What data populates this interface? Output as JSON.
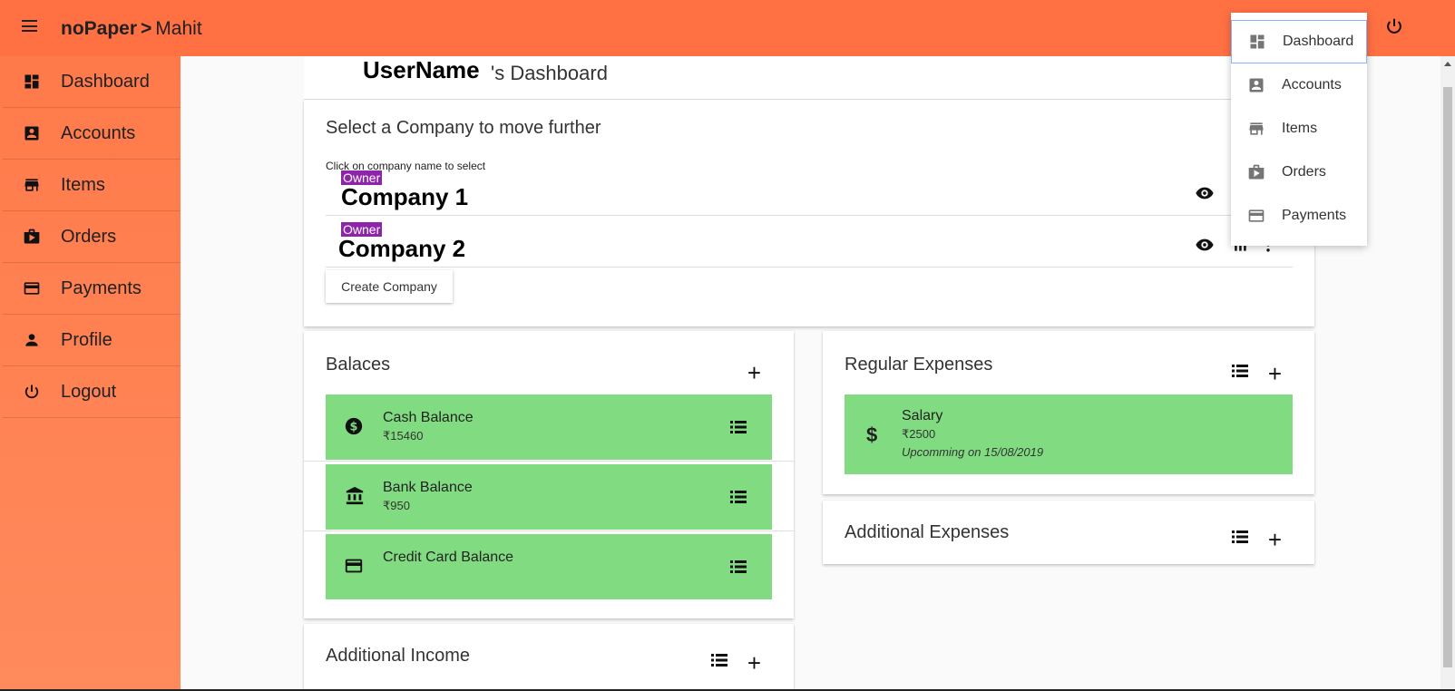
{
  "header": {
    "app_name": "noPaper",
    "separator": ">",
    "user": "Mahit"
  },
  "sidebar": {
    "items": [
      {
        "label": "Dashboard",
        "icon": "dashboard-icon"
      },
      {
        "label": "Accounts",
        "icon": "account-box-icon"
      },
      {
        "label": "Items",
        "icon": "store-icon"
      },
      {
        "label": "Orders",
        "icon": "shop-icon"
      },
      {
        "label": "Payments",
        "icon": "credit-card-icon"
      },
      {
        "label": "Profile",
        "icon": "person-icon"
      },
      {
        "label": "Logout",
        "icon": "power-icon"
      }
    ]
  },
  "dashboard": {
    "username": "UserName",
    "title_suffix": "'s Dashboard"
  },
  "companies": {
    "title": "Select a Company to move further",
    "hint": "Click on company name to select",
    "rows": [
      {
        "role": "Owner",
        "name": "Company 1"
      },
      {
        "role": "Owner",
        "name": "Company 2"
      }
    ],
    "create_label": "Create Company"
  },
  "balances": {
    "title": "Balaces",
    "items": [
      {
        "name": "Cash Balance",
        "value": "₹15460",
        "icon": "dollar-circle-icon"
      },
      {
        "name": "Bank Balance",
        "value": "₹950",
        "icon": "bank-icon"
      },
      {
        "name": "Credit Card Balance",
        "value": "",
        "icon": "credit-card-icon"
      }
    ]
  },
  "regular_expenses": {
    "title": "Regular Expenses",
    "items": [
      {
        "name": "Salary",
        "value": "₹2500",
        "note": "Upcomming on 15/08/2019"
      }
    ]
  },
  "additional_expenses": {
    "title": "Additional Expenses"
  },
  "additional_income": {
    "title": "Additional Income"
  },
  "menu": {
    "items": [
      {
        "label": "Dashboard",
        "active": true
      },
      {
        "label": "Accounts"
      },
      {
        "label": "Items"
      },
      {
        "label": "Orders"
      },
      {
        "label": "Payments"
      }
    ]
  },
  "colors": {
    "topbar": "#ff7043",
    "sidebar": "#ff8a5c",
    "balance_green": "#81dc81",
    "owner_tag": "#8e24aa"
  }
}
